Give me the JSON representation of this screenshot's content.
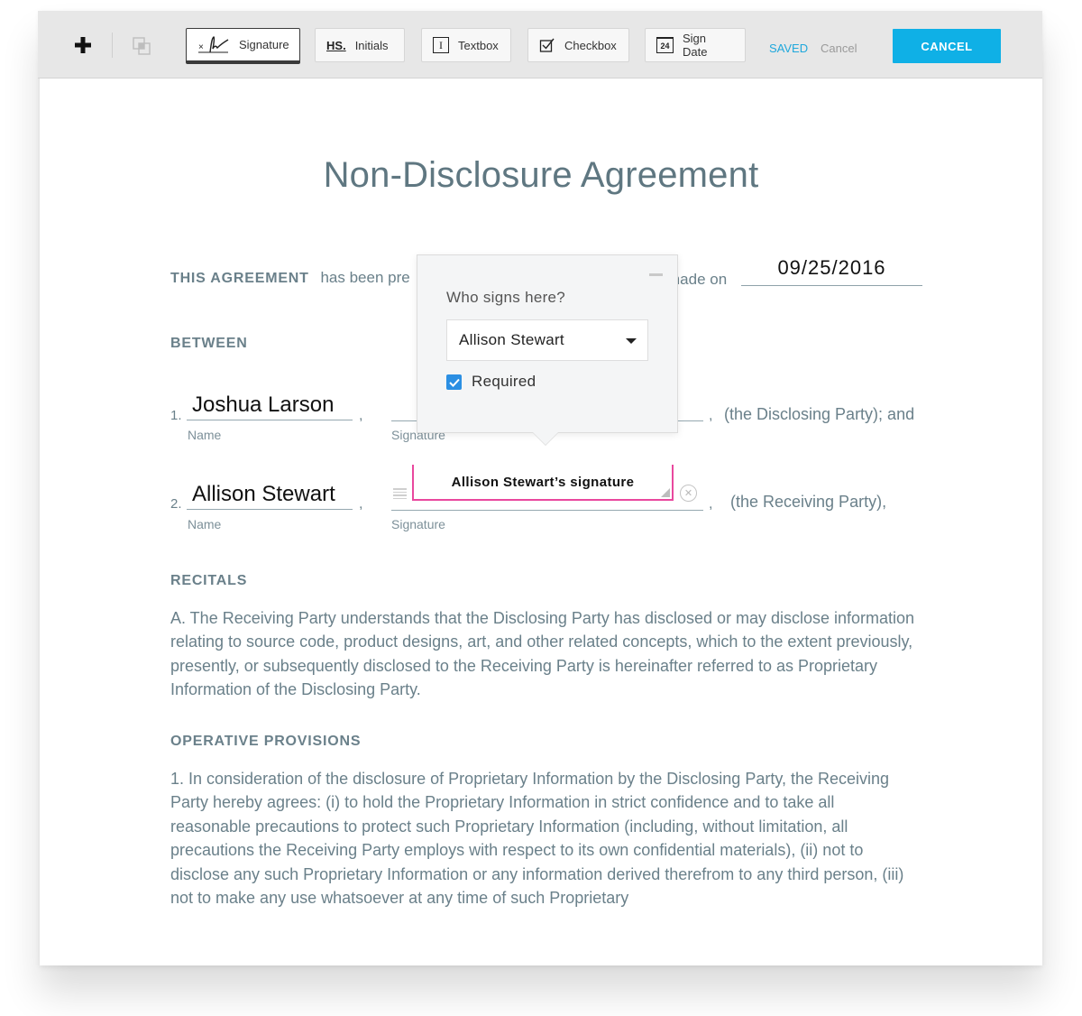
{
  "toolbar": {
    "add_icon": "plus-icon",
    "layers_icon": "layers-icon",
    "tools": [
      {
        "label": "Signature",
        "icon": "signature-icon",
        "active": true
      },
      {
        "label": "Initials",
        "icon": "initials-icon",
        "icon_text": "HS"
      },
      {
        "label": "Textbox",
        "icon": "textbox-icon",
        "icon_text": "I"
      },
      {
        "label": "Checkbox",
        "icon": "checkbox-icon"
      },
      {
        "label": "Sign Date",
        "icon": "calendar-icon",
        "icon_text": "24"
      }
    ],
    "status": "SAVED",
    "cancel_link": "Cancel",
    "cancel_button": "CANCEL"
  },
  "document": {
    "title": "Non-Disclosure Agreement",
    "agreement_label": "THIS AGREEMENT",
    "agreement_text": "has been pre",
    "made_on_text": "made on",
    "date_value": "09/25/2016",
    "between_label": "BETWEEN",
    "parties": [
      {
        "number": "1.",
        "name": "Joshua Larson",
        "name_label": "Name",
        "signature_label": "Signature",
        "role": "(the Disclosing Party); and"
      },
      {
        "number": "2.",
        "name": "Allison Stewart",
        "name_label": "Name",
        "signature_label": "Signature",
        "role": "(the Receiving Party),",
        "signature_field": "Allison Stewart’s signature"
      }
    ],
    "recitals_label": "RECITALS",
    "recitals_text": "A. The Receiving Party understands that the Disclosing Party has disclosed or may disclose information relating to source code, product designs, art, and other related concepts, which to the extent previously, presently, or subsequently disclosed to the Receiving Party is hereinafter referred to as Proprietary Information of the Disclosing Party.",
    "operative_label": "OPERATIVE PROVISIONS",
    "operative_text": "1. In consideration of the disclosure of Proprietary Information by the Disclosing Party, the Receiving Party hereby agrees: (i) to hold the Proprietary Information in strict confidence and to take all reasonable precautions to protect such Proprietary Information (including, without limitation, all precautions the Receiving Party employs with respect to its own confidential materials), (ii) not to disclose any such Proprietary Information or any information derived therefrom to any third person, (iii) not to make any use whatsoever at any time of such Proprietary"
  },
  "popover": {
    "question": "Who signs here?",
    "signer_selected": "Allison Stewart",
    "required_label": "Required",
    "required_checked": true
  },
  "colors": {
    "accent": "#0fb0e6",
    "saved": "#1fa8dc",
    "signature_border": "#e9489e",
    "checkbox": "#2b8fe3",
    "doc_text": "#6a808a"
  }
}
